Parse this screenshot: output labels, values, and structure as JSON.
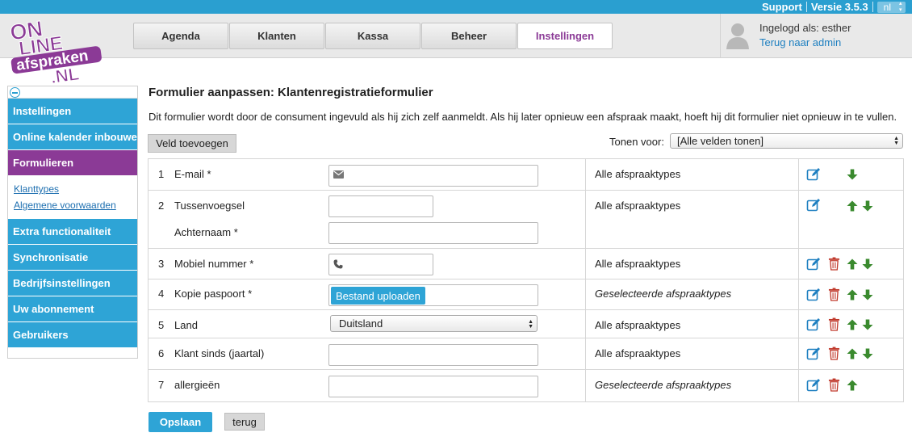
{
  "topbar": {
    "support": "Support",
    "version": "Versie 3.5.3",
    "language": "nl"
  },
  "logo": {
    "text": "ONLINE afspraken .NL"
  },
  "tabs": [
    {
      "label": "Agenda",
      "active": false
    },
    {
      "label": "Klanten",
      "active": false
    },
    {
      "label": "Kassa",
      "active": false
    },
    {
      "label": "Beheer",
      "active": false
    },
    {
      "label": "Instellingen",
      "active": true
    }
  ],
  "user": {
    "logged_in_as": "Ingelogd als: esther",
    "admin_link": "Terug naar admin"
  },
  "sidebar": {
    "items": [
      {
        "label": "Instellingen"
      },
      {
        "label": "Online kalender inbouwen"
      },
      {
        "label": "Formulieren",
        "active": true
      },
      {
        "label": "Extra functionaliteit"
      },
      {
        "label": "Synchronisatie"
      },
      {
        "label": "Bedrijfsinstellingen"
      },
      {
        "label": "Uw abonnement"
      },
      {
        "label": "Gebruikers"
      }
    ],
    "subitems": [
      "Klanttypes",
      "Algemene voorwaarden"
    ]
  },
  "main": {
    "title": "Formulier aanpassen: Klantenregistratieformulier",
    "description": "Dit formulier wordt door de consument ingevuld als hij zich zelf aanmeldt. Als hij later opnieuw een afspraak maakt, hoeft hij dit formulier niet opnieuw in te vullen.",
    "add_field": "Veld toevoegen",
    "show_for_label": "Tonen voor:",
    "show_for_value": "[Alle velden tonen]",
    "rows": [
      {
        "num": "1",
        "label": "E-mail *",
        "types": "Alle afspraaktypes"
      },
      {
        "num": "2",
        "label": "Tussenvoegsel",
        "label2": "Achternaam *",
        "types": "Alle afspraaktypes"
      },
      {
        "num": "3",
        "label": "Mobiel nummer *",
        "types": "Alle afspraaktypes"
      },
      {
        "num": "4",
        "label": "Kopie paspoort *",
        "types": "Geselecteerde afspraaktypes",
        "upload": "Bestand uploaden"
      },
      {
        "num": "5",
        "label": "Land",
        "types": "Alle afspraaktypes",
        "select": "Duitsland"
      },
      {
        "num": "6",
        "label": "Klant sinds (jaartal)",
        "types": "Alle afspraaktypes"
      },
      {
        "num": "7",
        "label": "allergieën",
        "types": "Geselecteerde afspraaktypes"
      }
    ],
    "save": "Opslaan",
    "back": "terug"
  },
  "colors": {
    "blue": "#2ea4d6",
    "purple": "#8b3a96",
    "green": "#3a8a2e",
    "red": "#c0392b"
  }
}
